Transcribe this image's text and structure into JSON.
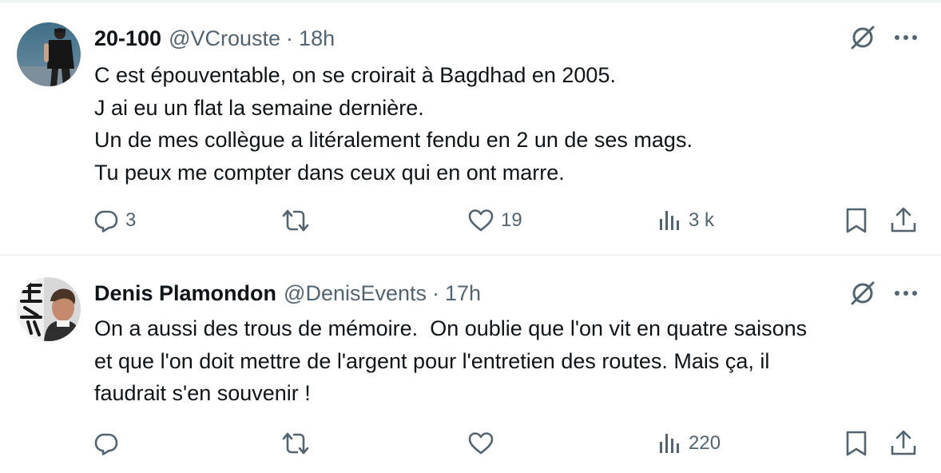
{
  "tweets": [
    {
      "display_name": "20-100",
      "handle": "@VCrouste",
      "separator": "·",
      "time": "18h",
      "body": [
        "C est épouventable, on se croirait à Bagdhad en 2005.",
        "J ai eu un flat la semaine dernière.",
        "Un de mes collègue a litéralement fendu en 2 un de ses mags.",
        "Tu peux me compter dans ceux qui en ont marre."
      ],
      "replies": "3",
      "reposts": "",
      "likes": "19",
      "views": "3 k"
    },
    {
      "display_name": "Denis Plamondon",
      "handle": "@DenisEvents",
      "separator": "·",
      "time": "17h",
      "body": [
        "On a aussi des trous de mémoire.  On oublie que l'on vit en quatre saisons",
        "et que l'on doit mettre de l'argent pour l'entretien des routes. Mais ça, il",
        "faudrait s'en souvenir !"
      ],
      "replies": "",
      "reposts": "",
      "likes": "",
      "views": "220"
    }
  ],
  "icons": {
    "reply": "reply-icon",
    "repost": "repost-icon",
    "like": "heart-icon",
    "views": "views-icon",
    "bookmark": "bookmark-icon",
    "share": "share-icon",
    "grok": "grok-icon",
    "more": "more-icon"
  },
  "colors": {
    "text": "#0f1419",
    "secondary": "#536471",
    "divider": "#eff3f4"
  }
}
